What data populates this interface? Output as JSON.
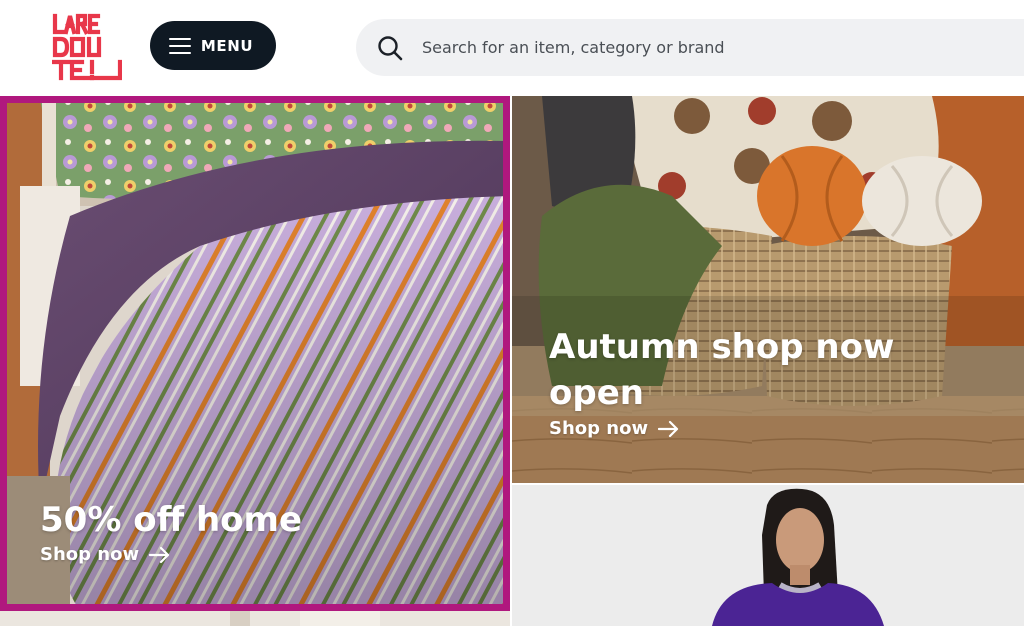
{
  "header": {
    "logo_text": "LA REDOUTE",
    "menu_label": "MENU",
    "search_placeholder": "Search for an item, category or brand"
  },
  "promos": {
    "home": {
      "title": "50% off home",
      "link": "Shop now"
    },
    "autumn": {
      "title": "Autumn shop now open",
      "link": "Shop now"
    }
  },
  "colors": {
    "brand_red": "#e8374a",
    "menu_bg": "#0f1923",
    "active_frame": "#b0187e",
    "search_bg": "#f0f1f3"
  },
  "icons": [
    "hamburger-icon",
    "search-icon",
    "arrow-right-icon"
  ]
}
